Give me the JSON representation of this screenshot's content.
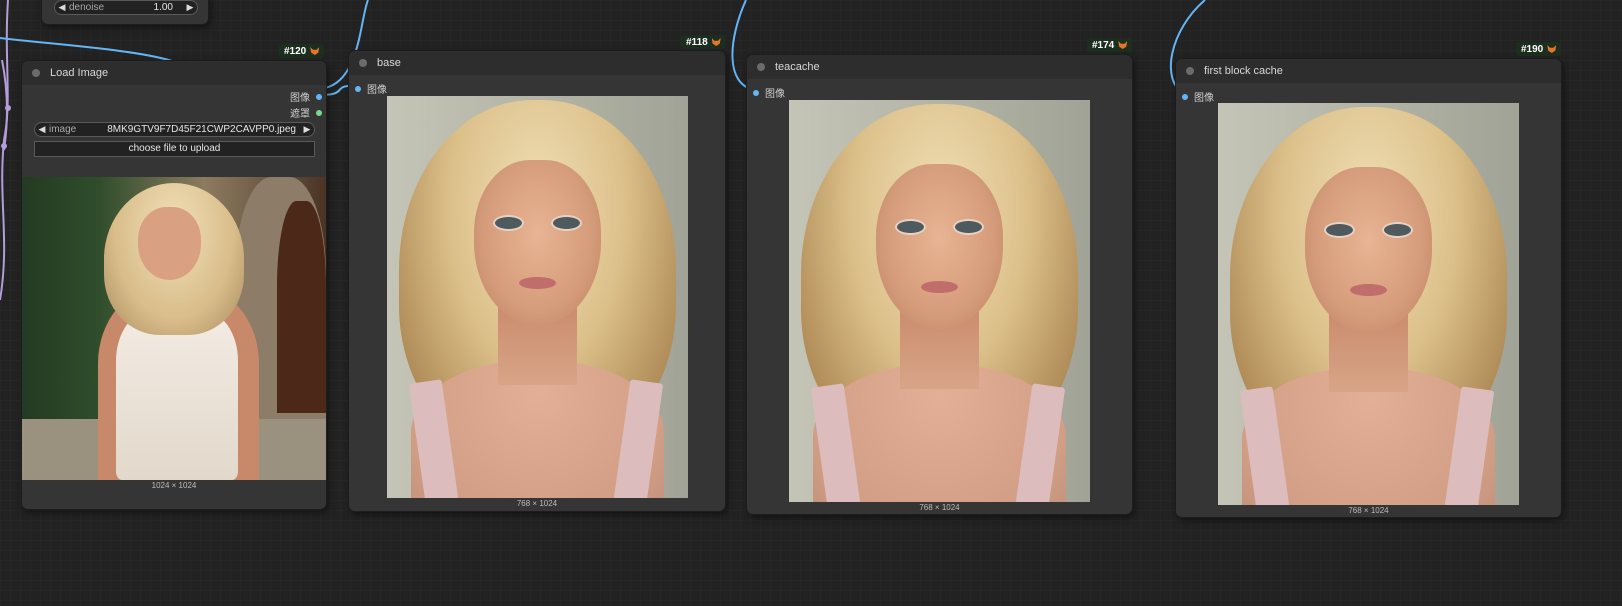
{
  "colors": {
    "canvas": "#222222",
    "node_body": "#353535",
    "node_header": "#2d2d2d",
    "image_link": "#64b5f6",
    "mask_link": "#7bd88f",
    "model_link": "#b39ddb",
    "badge_bg": "#1c2f1f"
  },
  "top_widget": {
    "label": "denoise",
    "value": "1.00"
  },
  "nodes": {
    "load_image": {
      "id": "#120",
      "title": "Load Image",
      "outputs": [
        "图像",
        "遮罩"
      ],
      "image_widget": {
        "label": "image",
        "value": "8MK9GTV9F7D45F21CWP2CAVPP0.jpeg"
      },
      "upload_button": "choose file to upload",
      "dims": "1024 × 1024"
    },
    "base": {
      "id": "#118",
      "title": "base",
      "input": "图像",
      "dims": "768 × 1024"
    },
    "teacache": {
      "id": "#174",
      "title": "teacache",
      "input": "图像",
      "dims": "768 × 1024"
    },
    "first_block_cache": {
      "id": "#190",
      "title": "first block cache",
      "input": "图像",
      "dims": "768 × 1024"
    }
  },
  "icons": {
    "prev": "triangle-left-icon",
    "next": "triangle-right-icon",
    "badge": "fox-icon",
    "collapse": "collapse-dot-icon"
  }
}
